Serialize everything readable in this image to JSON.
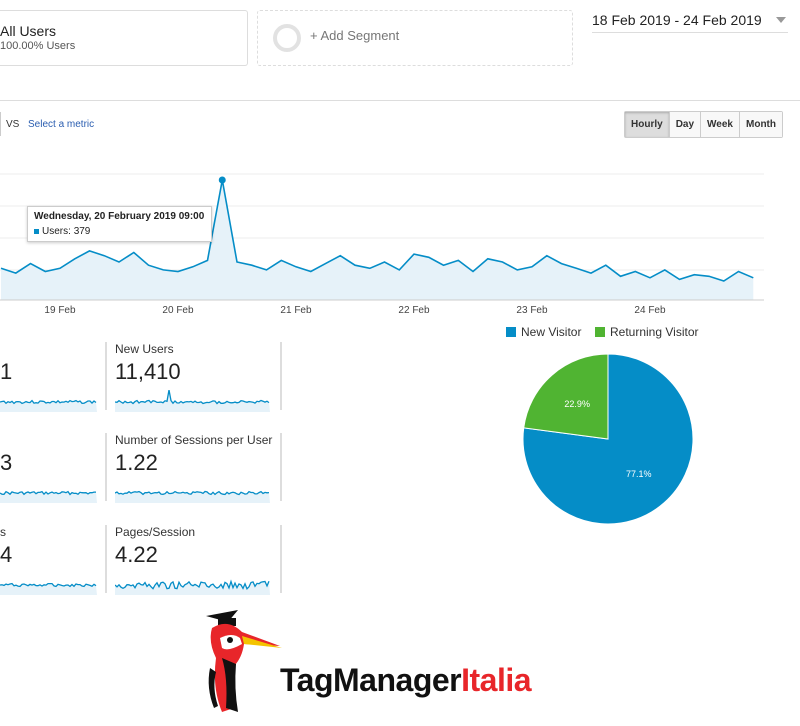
{
  "segments": {
    "all_users": {
      "title": "All Users",
      "subtitle": "100.00% Users"
    },
    "add_segment": "+ Add Segment"
  },
  "date_range": "18 Feb 2019 - 24 Feb 2019",
  "chart_controls": {
    "vs": "VS",
    "select_metric": "Select a metric",
    "buttons": [
      "Hourly",
      "Day",
      "Week",
      "Month"
    ],
    "active": "Hourly"
  },
  "chart_data": {
    "type": "line",
    "metric": "Users",
    "granularity": "hourly (sampled every 3 hours)",
    "x_ticks": [
      "19 Feb",
      "20 Feb",
      "21 Feb",
      "22 Feb",
      "23 Feb",
      "24 Feb"
    ],
    "start": "18 Feb 2019 00:00",
    "values": [
      80,
      110,
      95,
      120,
      100,
      85,
      115,
      90,
      100,
      130,
      155,
      140,
      120,
      150,
      110,
      95,
      90,
      105,
      125,
      379,
      120,
      110,
      95,
      125,
      105,
      90,
      115,
      140,
      110,
      100,
      120,
      95,
      145,
      135,
      110,
      125,
      90,
      130,
      120,
      95,
      105,
      140,
      115,
      100,
      85,
      110,
      75,
      90,
      70,
      95,
      65,
      80,
      75,
      60,
      90,
      70,
      130,
      80,
      70,
      65,
      85,
      60,
      75,
      95,
      85,
      100,
      110,
      90,
      95,
      80
    ],
    "tooltip": {
      "title": "Wednesday, 20 February 2019 09:00",
      "series": "Users",
      "value": 379
    },
    "color": "#058dc7",
    "fill": "#e6f2f9"
  },
  "metrics": [
    {
      "label": "",
      "value": "1"
    },
    {
      "label": "New Users",
      "value": "11,410"
    },
    {
      "label": "",
      "value": "3"
    },
    {
      "label": "Number of Sessions per User",
      "value": "1.22"
    },
    {
      "label": "s",
      "value": "4"
    },
    {
      "label": "Pages/Session",
      "value": "4.22"
    }
  ],
  "pie": {
    "legend": [
      {
        "name": "New Visitor",
        "color": "#058dc7"
      },
      {
        "name": "Returning Visitor",
        "color": "#50b432"
      }
    ],
    "slices": [
      {
        "name": "New Visitor",
        "value": 77.1,
        "label": "77.1%"
      },
      {
        "name": "Returning Visitor",
        "value": 22.9,
        "label": "22.9%"
      }
    ]
  },
  "logo": {
    "text_a": "TagManager",
    "text_b": "Italia",
    "color_a": "#111111",
    "color_b": "#e8262a"
  }
}
